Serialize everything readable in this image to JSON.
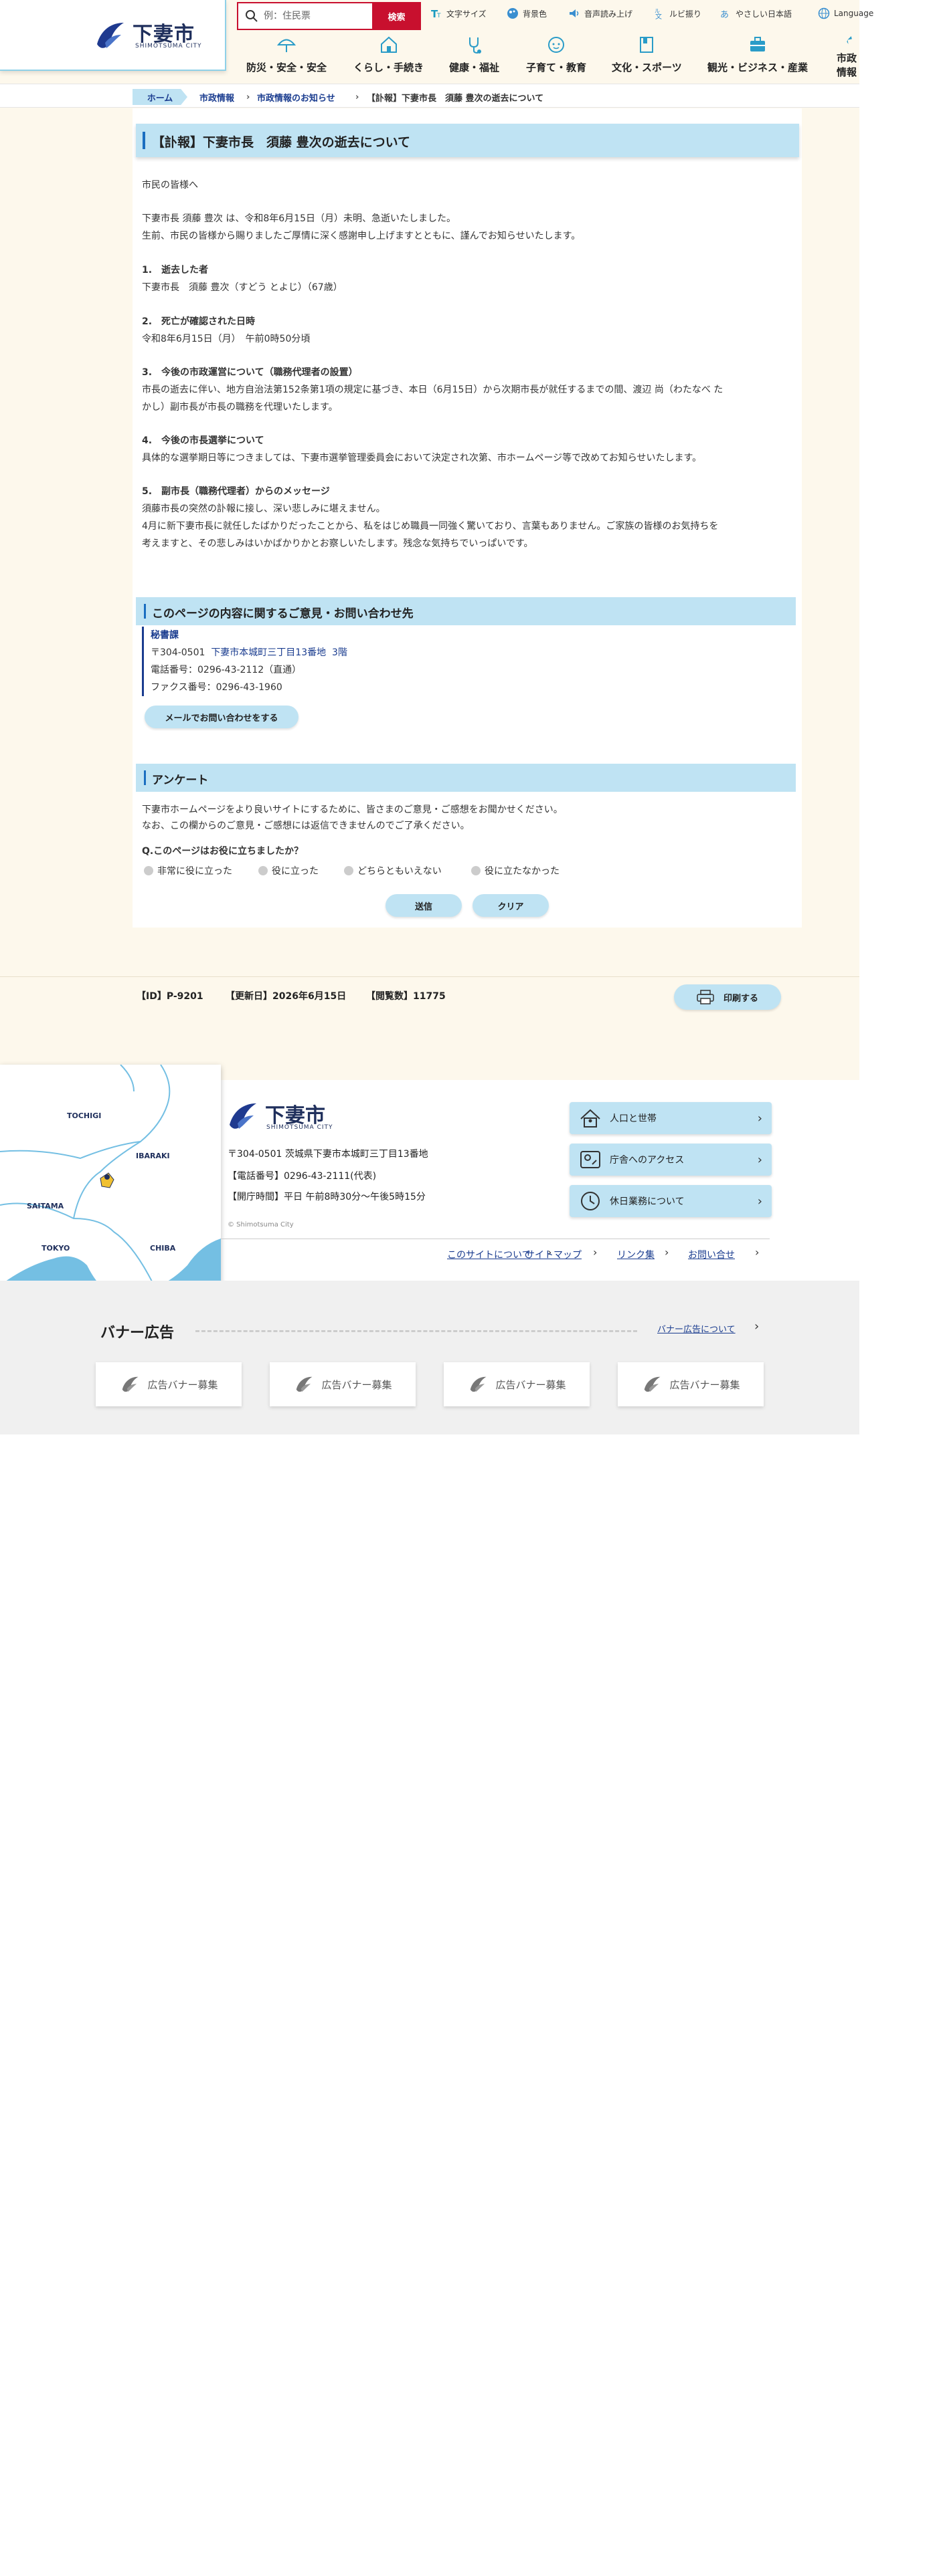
{
  "header": {
    "logo_name": "下妻市",
    "logo_sub": "SHIMOTSUMA CITY",
    "search_placeholder": "例：住民票",
    "search_button": "検索",
    "utility": [
      {
        "label": "文字サイズ",
        "icon": "text-size-icon"
      },
      {
        "label": "背景色",
        "icon": "palette-icon"
      },
      {
        "label": "音声読み上げ",
        "icon": "speaker-icon"
      },
      {
        "label": "ルビ振り",
        "icon": "ruby-icon"
      },
      {
        "label": "やさしい日本語",
        "icon": "easy-japanese-icon"
      },
      {
        "label": "Language",
        "icon": "globe-icon"
      }
    ],
    "global_nav": [
      {
        "label": "防災・安全・安全",
        "icon": "umbrella-icon"
      },
      {
        "label": "くらし・手続き",
        "icon": "house-icon"
      },
      {
        "label": "健康・福祉",
        "icon": "stethoscope-icon"
      },
      {
        "label": "子育て・教育",
        "icon": "child-icon"
      },
      {
        "label": "文化・スポーツ",
        "icon": "book-icon"
      },
      {
        "label": "観光・ビジネス・産業",
        "icon": "briefcase-icon"
      },
      {
        "label": "市政情報",
        "icon": "flag-icon"
      }
    ]
  },
  "breadcrumb": {
    "home": "ホーム",
    "items": [
      "市政情報",
      "市政情報のお知らせ"
    ],
    "current": "【訃報】下妻市長　須藤 豊次の逝去について"
  },
  "article": {
    "title": "【訃報】下妻市長　須藤 豊次の逝去について",
    "greeting": "市民の皆様へ",
    "intro_1": "下妻市長 須藤 豊次 は、令和8年6月15日（月）未明、急逝いたしました。",
    "intro_2": "生前、市民の皆様から賜りましたご厚情に深く感謝申し上げますとともに、謹んでお知らせいたします。",
    "s1_head": "1.　逝去した者",
    "s1_body": "下妻市長　須藤 豊次（すどう とよじ）（67歳）",
    "s2_head": "2.　死亡が確認された日時",
    "s2_body": "令和8年6月15日（月）　午前0時50分頃",
    "s3_head": "3.　今後の市政運営について（職務代理者の設置）",
    "s3_body_1": "市長の逝去に伴い、地方自治法第152条第1項の規定に基づき、本日（6月15日）から次期市長が就任するまでの間、渡辺 尚（わたなべ た",
    "s3_body_2": "かし）副市長が市長の職務を代理いたします。",
    "s4_head": "4.　今後の市長選挙について",
    "s4_body": "具体的な選挙期日等につきましては、下妻市選挙管理委員会において決定され次第、市ホームページ等で改めてお知らせいたします。",
    "s5_head": "5.　副市長（職務代理者）からのメッセージ",
    "s5_body_1": "須藤市長の突然の訃報に接し、深い悲しみに堪えません。",
    "s5_body_2": "4月に新下妻市長に就任したばかりだったことから、私をはじめ職員一同強く驚いており、言葉もありません。ご家族の皆様のお気持ちを",
    "s5_body_3": "考えますと、その悲しみはいかばかりかとお察しいたします。残念な気持ちでいっぱいです。"
  },
  "contact": {
    "heading": "このページの内容に関するご意見・お問い合わせ先",
    "dept": "秘書課",
    "postal_prefix": "〒304-0501",
    "address_link": "下妻市本城町三丁目13番地",
    "floor_link": "3階",
    "tel": "電話番号：0296-43-2112（直通）",
    "fax": "ファクス番号：0296-43-1960",
    "mail_button": "メールでお問い合わせをする"
  },
  "survey": {
    "heading": "アンケート",
    "desc_1": "下妻市ホームページをより良いサイトにするために、皆さまのご意見・ご感想をお聞かせください。",
    "desc_2": "なお、この欄からのご意見・ご感想には返信できませんのでご了承ください。",
    "question": "Q.このページはお役に立ちましたか？",
    "options": [
      "非常に役に立った",
      "役に立った",
      "どちらともいえない",
      "役に立たなかった"
    ],
    "submit": "送信",
    "clear": "クリア"
  },
  "meta": {
    "id": "【ID】P-9201",
    "updated": "【更新日】2026年6月15日",
    "views": "【閲覧数】11775",
    "print": "印刷する"
  },
  "footer": {
    "map_labels": [
      "TOCHIGI",
      "IBARAKI",
      "SAITAMA",
      "TOKYO",
      "CHIBA"
    ],
    "logo_name": "下妻市",
    "logo_sub": "SHIMOTSUMA CITY",
    "address": "〒304-0501 茨城県下妻市本城町三丁目13番地",
    "phone": "【電話番号】0296-43-2111(代表)",
    "hours": "【開庁時間】平日 午前8時30分～午後5時15分",
    "copyright": "© Shimotsuma City",
    "link_buttons": [
      {
        "label": "人口と世帯",
        "icon": "population-icon"
      },
      {
        "label": "庁舎へのアクセス",
        "icon": "map-access-icon"
      },
      {
        "label": "休日業務について",
        "icon": "clock-icon"
      }
    ],
    "nav": [
      "このサイトについて",
      "サイトマップ",
      "リンク集",
      "お問い合せ"
    ],
    "banner_title": "バナー広告",
    "banner_link": "バナー広告について",
    "banner_cards": [
      "広告バナー募集",
      "広告バナー募集",
      "広告バナー募集",
      "広告バナー募集"
    ]
  },
  "colors": {
    "accent_light": "#bfe3f3",
    "accent_dark": "#1a6ec0",
    "search_red": "#c8102e",
    "page_bg": "#fdf8ec"
  }
}
